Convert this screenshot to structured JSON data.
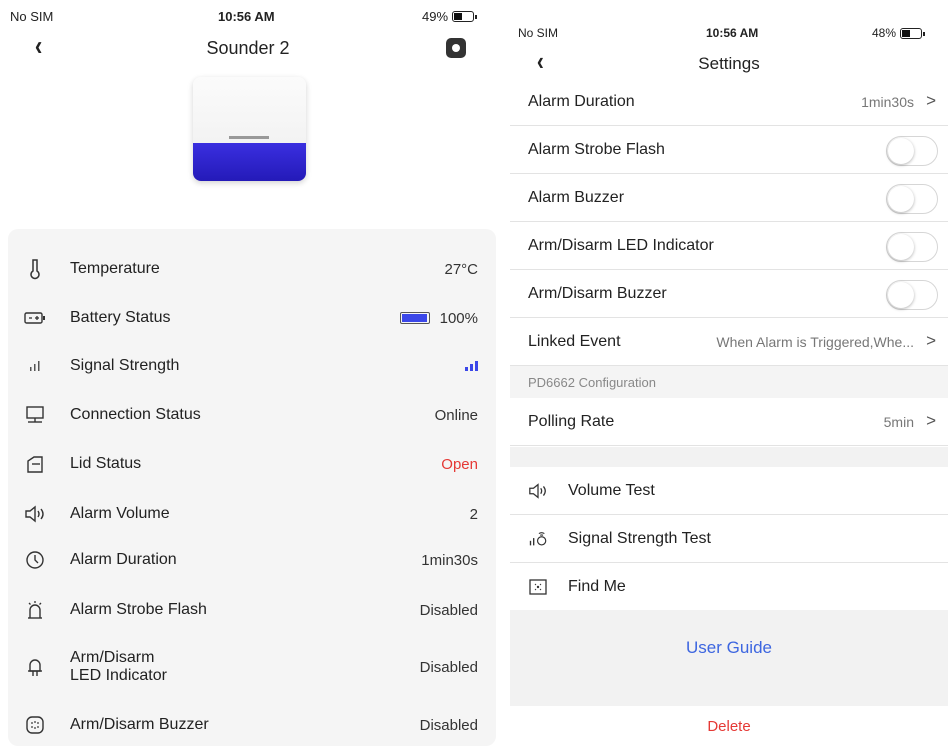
{
  "left": {
    "status": {
      "carrier": "No SIM",
      "time": "10:56 AM",
      "battery": "49%",
      "battery_level": 0.49
    },
    "title": "Sounder 2",
    "rows": [
      {
        "icon": "thermometer-icon",
        "label": "Temperature",
        "value": "27°C"
      },
      {
        "icon": "battery-icon",
        "label": "Battery Status",
        "value": "100%",
        "level": 1.0
      },
      {
        "icon": "signal-icon",
        "label": "Signal Strength",
        "value": ""
      },
      {
        "icon": "monitor-icon",
        "label": "Connection Status",
        "value": "Online"
      },
      {
        "icon": "lid-icon",
        "label": "Lid Status",
        "value": "Open"
      },
      {
        "icon": "speaker-icon",
        "label": "Alarm Volume",
        "value": "2"
      },
      {
        "icon": "clock-icon",
        "label": "Alarm Duration",
        "value": "1min30s"
      },
      {
        "icon": "strobe-icon",
        "label": "Alarm Strobe Flash",
        "value": "Disabled"
      },
      {
        "icon": "led-icon",
        "label": "Arm/Disarm\nLED Indicator",
        "value": "Disabled"
      },
      {
        "icon": "buzzer-icon",
        "label": "Arm/Disarm Buzzer",
        "value": "Disabled"
      }
    ],
    "colors": {
      "accent": "#3b47e8",
      "alert": "#e53935",
      "device_band": "#2a1fd0"
    }
  },
  "right": {
    "status": {
      "carrier": "No SIM",
      "time": "10:56 AM",
      "battery": "48%",
      "battery_level": 0.48
    },
    "title": "Settings",
    "rows": [
      {
        "label": "Alarm Duration",
        "value": "1min30s",
        "chevron": ">"
      },
      {
        "label": "Alarm Strobe Flash",
        "toggle": false
      },
      {
        "label": "Alarm Buzzer",
        "toggle": false
      },
      {
        "label": "Arm/Disarm LED Indicator",
        "toggle": false
      },
      {
        "label": "Arm/Disarm Buzzer",
        "toggle": false
      },
      {
        "label": "Linked Event",
        "value": "When Alarm is Triggered,Whe...",
        "chevron": ">"
      }
    ],
    "section": "PD6662 Configuration",
    "polling": {
      "label": "Polling Rate",
      "value": "5min",
      "chevron": ">"
    },
    "tests": [
      {
        "icon": "speaker-icon",
        "label": "Volume Test"
      },
      {
        "icon": "signal-test-icon",
        "label": "Signal Strength Test"
      },
      {
        "icon": "find-me-icon",
        "label": "Find Me"
      }
    ],
    "user_guide": "User Guide",
    "delete": "Delete",
    "colors": {
      "link": "#3d66e0",
      "danger": "#e53935"
    }
  }
}
